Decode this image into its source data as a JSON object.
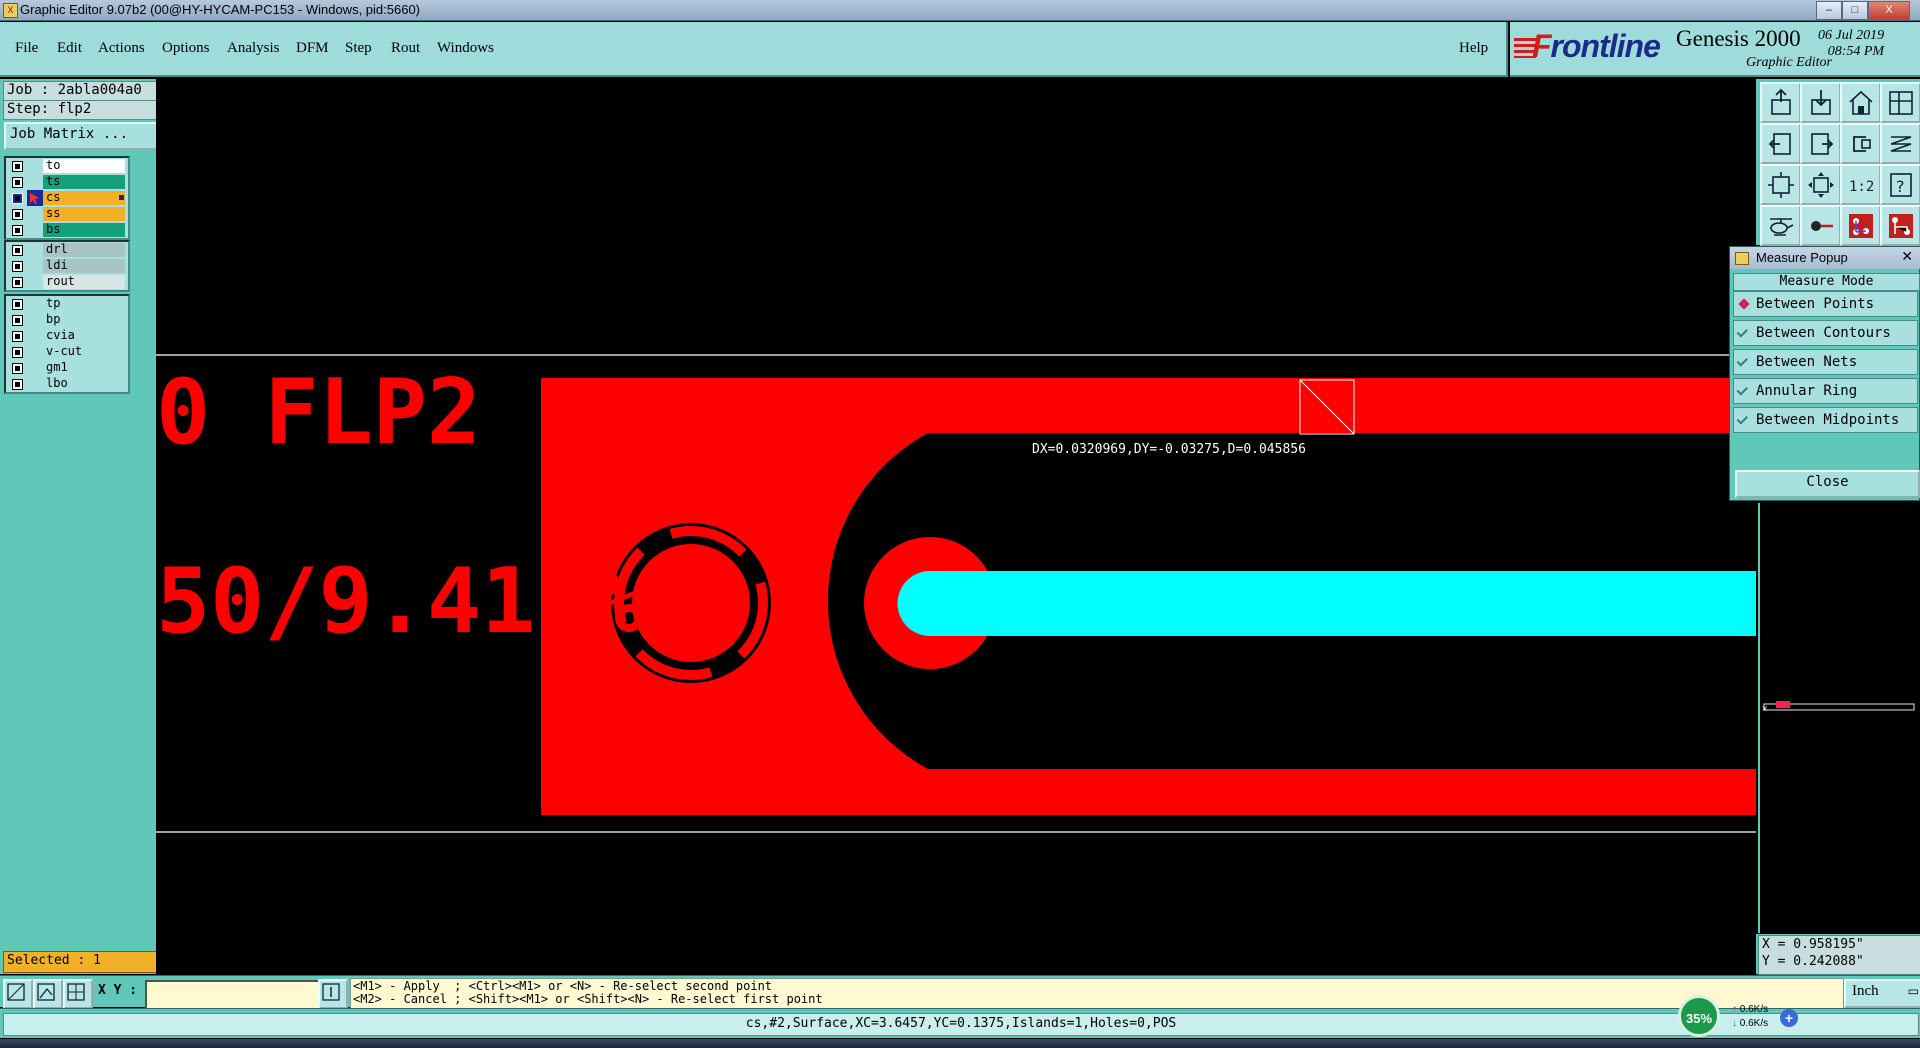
{
  "window": {
    "title": "Graphic Editor 9.07b2 (00@HY-HYCAM-PC153 - Windows, pid:5660)",
    "app_icon_glyph": "X",
    "controls": [
      "–",
      "□",
      "X"
    ]
  },
  "menu": [
    "File",
    "Edit",
    "Actions",
    "Options",
    "Analysis",
    "DFM",
    "Step",
    "Rout",
    "Windows"
  ],
  "help_label": "Help",
  "brand": {
    "logo_first": "F",
    "logo_rest": "rontline",
    "product": "Genesis 2000",
    "subtitle": "Graphic Editor",
    "date": "06 Jul 2019",
    "time": "08:54 PM"
  },
  "job": {
    "job_label": "Job : 2abla004a0",
    "step_label": "Step: flp2",
    "matrix_button": "Job Matrix ..."
  },
  "layer_groups": [
    [
      {
        "name": "to",
        "color": "#ffffff"
      },
      {
        "name": "ts",
        "color": "#14a07a"
      },
      {
        "name": "cs",
        "color": "#f2b028",
        "active": true
      },
      {
        "name": "ss",
        "color": "#f2b028"
      },
      {
        "name": "bs",
        "color": "#14a07a"
      }
    ],
    [
      {
        "name": "drl",
        "color": "#a8c4c4"
      },
      {
        "name": "ldi",
        "color": "#a8c4c4"
      },
      {
        "name": "rout",
        "color": "#d8e6e6"
      }
    ],
    [
      {
        "name": "tp",
        "color": "#a8e0e0"
      },
      {
        "name": "bp",
        "color": "#a8e0e0"
      },
      {
        "name": "cvia",
        "color": "#a8e0e0"
      },
      {
        "name": "v-cut",
        "color": "#a8e0e0"
      },
      {
        "name": "gm1",
        "color": "#a8e0e0"
      },
      {
        "name": "lbo",
        "color": "#a8e0e0"
      }
    ]
  ],
  "selected_label": "Selected : 1",
  "canvas": {
    "text_line1": "0 FLP2",
    "text_line2": "50/9.41 %",
    "measure_readout": "DX=0.0320969,DY=-0.03275,D=0.045856",
    "colors": {
      "copper": "#ff0000",
      "highlight": "#00ffff",
      "background": "#000000",
      "profile": "#d8d8d8"
    }
  },
  "measure_popup": {
    "title": "Measure Popup",
    "mode_header": "Measure Mode",
    "options": [
      {
        "label": "Between Points",
        "selected": true
      },
      {
        "label": "Between Contours",
        "selected": false
      },
      {
        "label": "Between Nets",
        "selected": false
      },
      {
        "label": "Annular Ring",
        "selected": false
      },
      {
        "label": "Between Midpoints",
        "selected": false
      }
    ],
    "close_label": "Close"
  },
  "toolbar_icons": [
    "export-icon",
    "import-icon",
    "home-icon",
    "layout-icon",
    "pan-left-icon",
    "pan-right-icon",
    "redraw-icon",
    "snap-icon",
    "zoom-fit-icon",
    "zoom-center-icon",
    "scale-icon",
    "help-icon",
    "helicopter-icon",
    "probe-icon",
    "net-icon",
    "netlist-icon"
  ],
  "coords": {
    "x": "X = 0.958195\"",
    "y": "Y = 0.242088\""
  },
  "command_bar": {
    "xy_label": "X Y :",
    "xy_value": "",
    "hint_line1": "<M1> - Apply  ; <Ctrl><M1> or <N> - Re-select second point",
    "hint_line2": "<M2> - Cancel ; <Shift><M1> or <Shift><N> - Re-select first point",
    "unit": "Inch"
  },
  "status": "cs,#2,Surface,XC=3.6457,YC=0.1375,Islands=1,Holes=0,POS",
  "net_widget": {
    "percent": "35%",
    "up": "0.6K/s",
    "down": "0.6K/s",
    "plus": "+"
  }
}
